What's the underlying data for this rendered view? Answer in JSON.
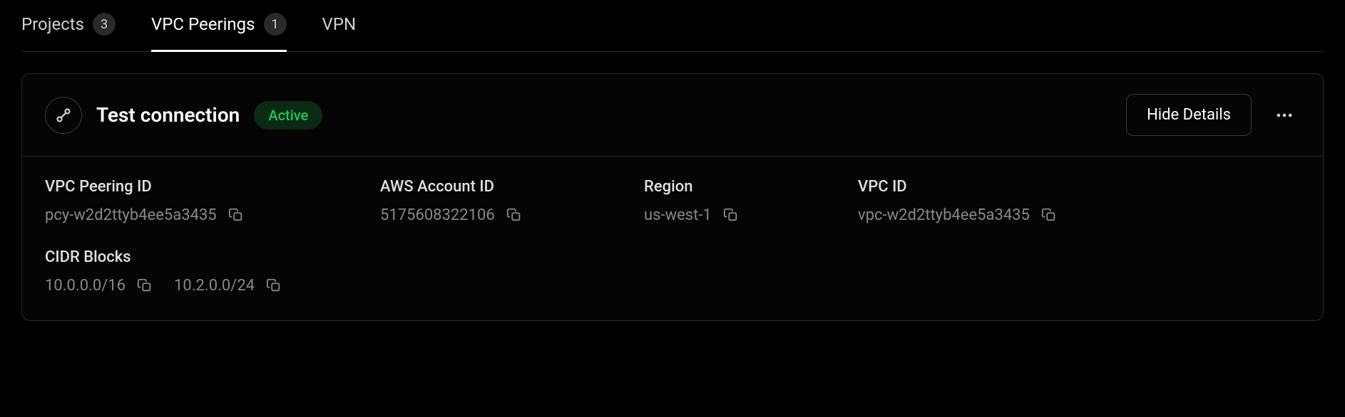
{
  "tabs": {
    "projects": {
      "label": "Projects",
      "count": "3"
    },
    "vpc_peerings": {
      "label": "VPC Peerings",
      "count": "1"
    },
    "vpn": {
      "label": "VPN"
    }
  },
  "peering": {
    "title": "Test connection",
    "status": "Active",
    "hide_details_label": "Hide Details",
    "details": {
      "vpc_peering_id": {
        "label": "VPC Peering ID",
        "value": "pcy-w2d2ttyb4ee5a3435"
      },
      "aws_account_id": {
        "label": "AWS Account ID",
        "value": "5175608322106"
      },
      "region": {
        "label": "Region",
        "value": "us-west-1"
      },
      "vpc_id": {
        "label": "VPC ID",
        "value": "vpc-w2d2ttyb4ee5a3435"
      },
      "cidr_blocks": {
        "label": "CIDR Blocks",
        "values": [
          "10.0.0.0/16",
          "10.2.0.0/24"
        ]
      }
    }
  }
}
